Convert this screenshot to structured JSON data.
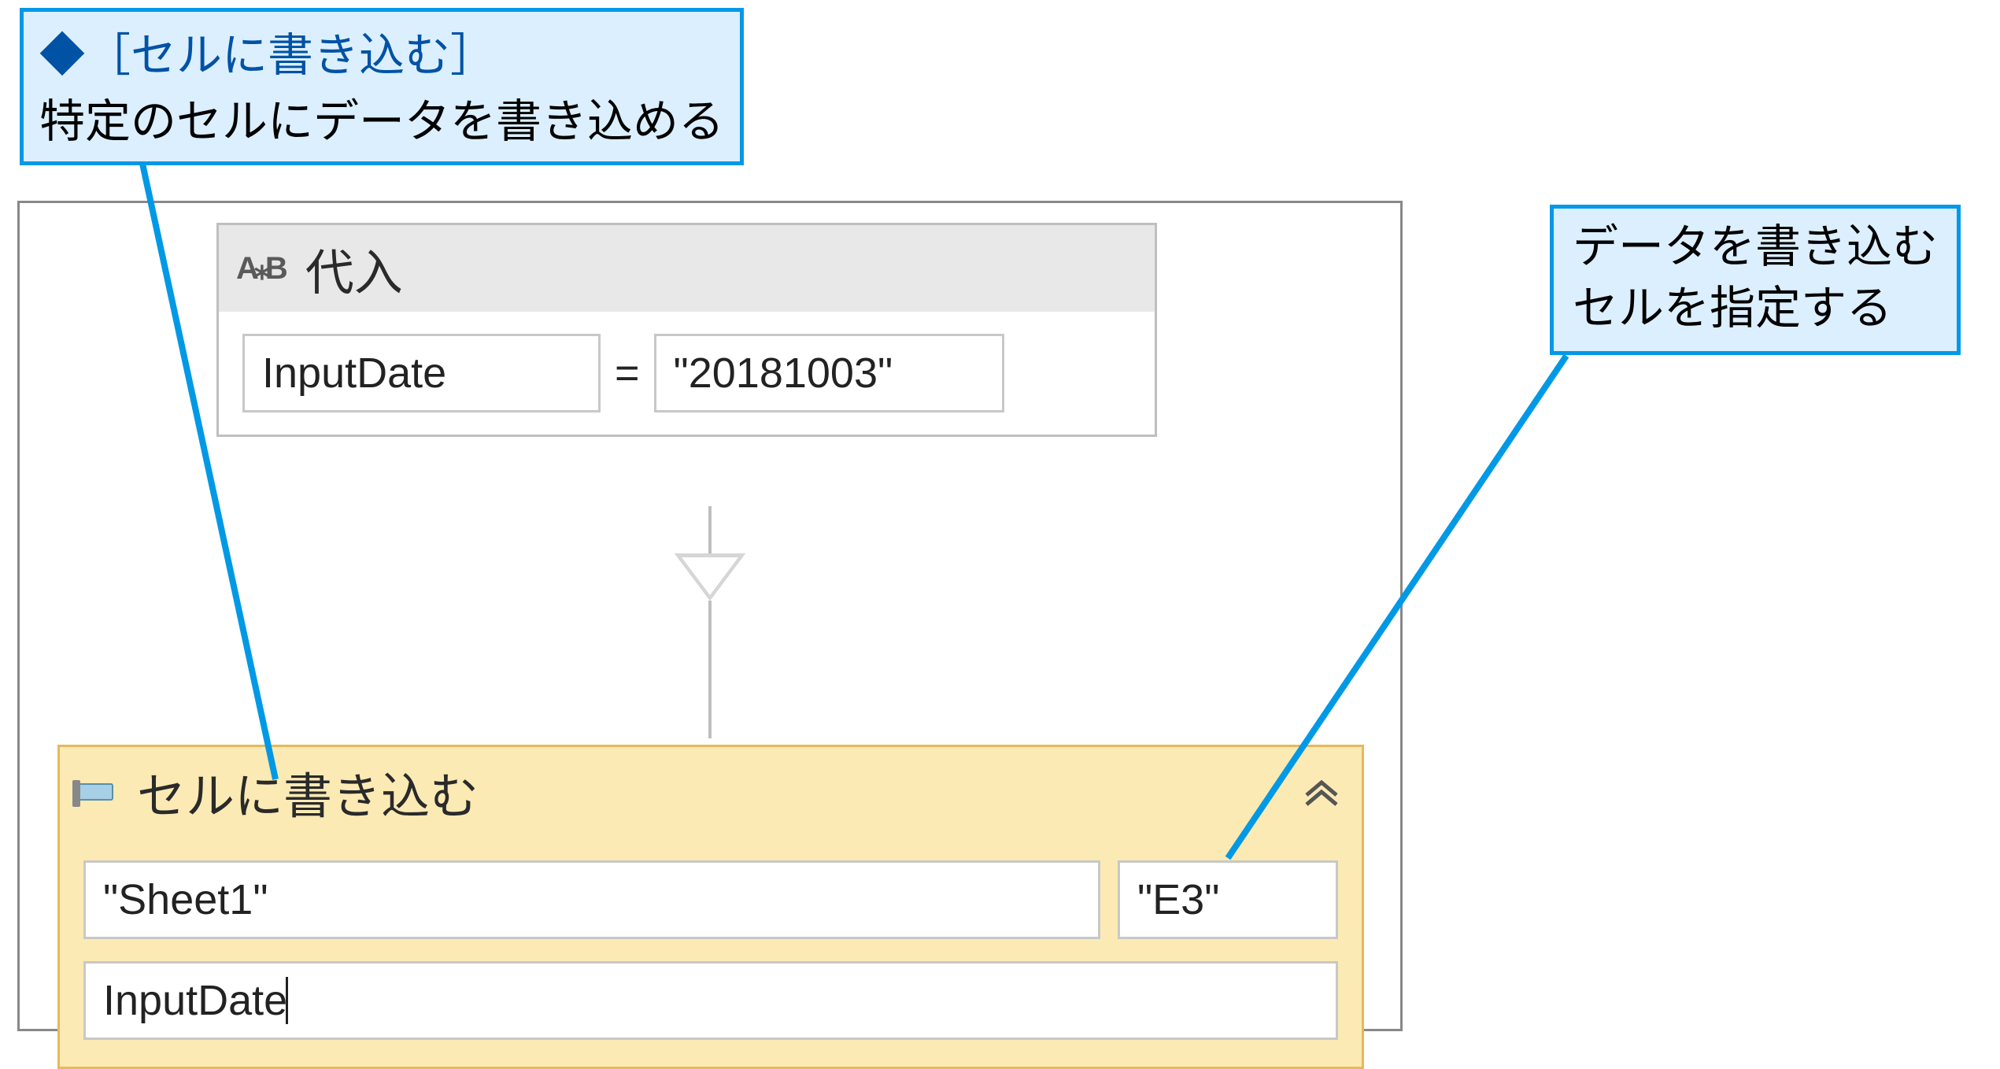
{
  "callouts": {
    "left": {
      "title": "◆［セルに書き込む］",
      "desc": "特定のセルにデータを書き込める"
    },
    "right": {
      "line1": "データを書き込む",
      "line2": "セルを指定する"
    }
  },
  "assign": {
    "icon_text": "A⁎B",
    "title": "代入",
    "left_field": "InputDate",
    "equals": "=",
    "right_field": "\"20181003\""
  },
  "write_cell": {
    "title": "セルに書き込む",
    "sheet": "\"Sheet1\"",
    "cell": "\"E3\"",
    "value": "InputDate"
  }
}
